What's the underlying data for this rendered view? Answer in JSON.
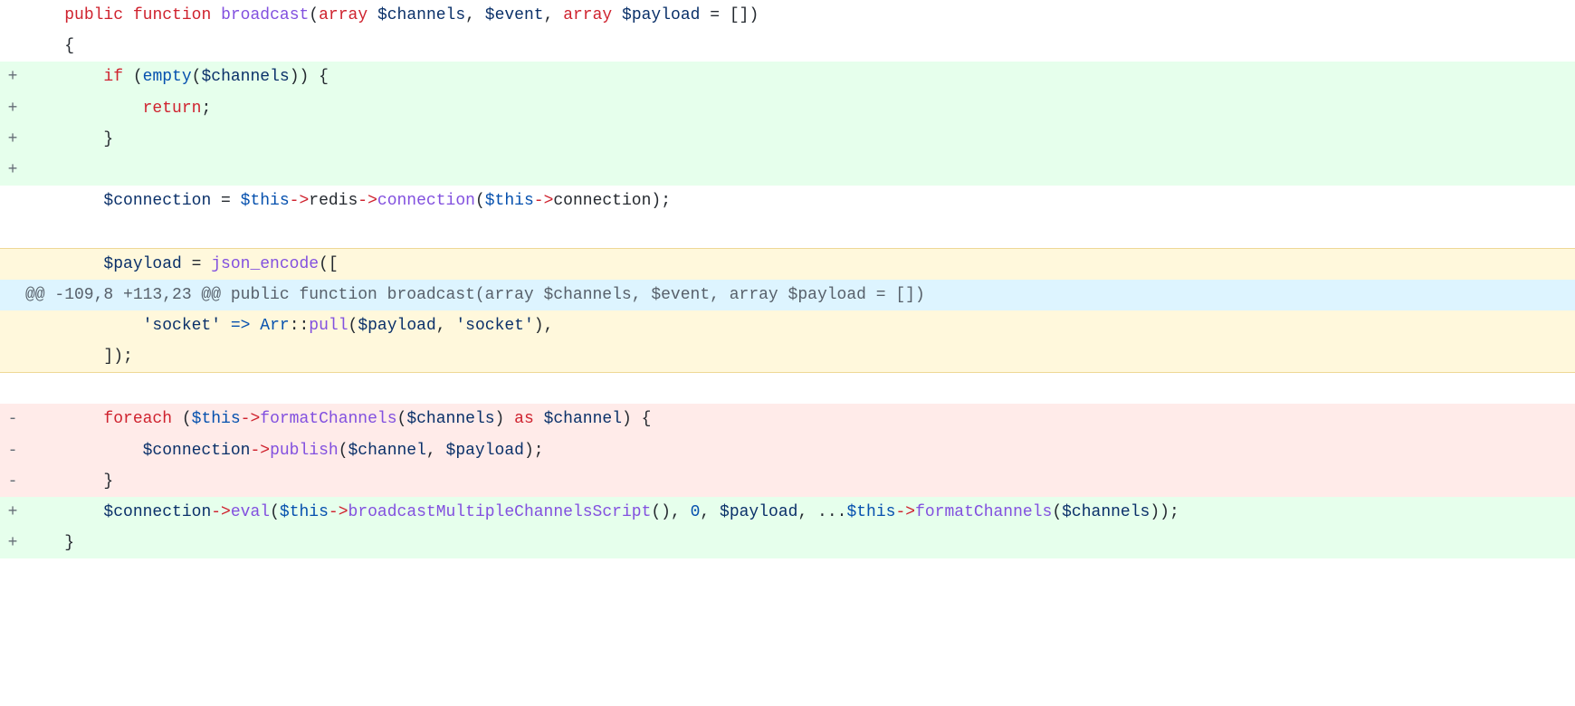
{
  "lines": [
    {
      "type": "context",
      "marker": "",
      "indent": "    ",
      "tokens": [
        {
          "t": "public",
          "c": "kw"
        },
        {
          "t": " "
        },
        {
          "t": "function",
          "c": "kw"
        },
        {
          "t": " "
        },
        {
          "t": "broadcast",
          "c": "fn"
        },
        {
          "t": "("
        },
        {
          "t": "array",
          "c": "kw"
        },
        {
          "t": " "
        },
        {
          "t": "$channels",
          "c": "var"
        },
        {
          "t": ", "
        },
        {
          "t": "$event",
          "c": "var"
        },
        {
          "t": ", "
        },
        {
          "t": "array",
          "c": "kw"
        },
        {
          "t": " "
        },
        {
          "t": "$payload",
          "c": "var"
        },
        {
          "t": " = []"
        },
        {
          "t": ")"
        }
      ]
    },
    {
      "type": "context",
      "marker": "",
      "indent": "    ",
      "tokens": [
        {
          "t": "{"
        }
      ]
    },
    {
      "type": "addition",
      "marker": "+",
      "indent": "        ",
      "tokens": [
        {
          "t": "if",
          "c": "kw"
        },
        {
          "t": " ("
        },
        {
          "t": "empty",
          "c": "kw-blue"
        },
        {
          "t": "("
        },
        {
          "t": "$channels",
          "c": "var"
        },
        {
          "t": ")) {"
        }
      ]
    },
    {
      "type": "addition",
      "marker": "+",
      "indent": "            ",
      "tokens": [
        {
          "t": "return",
          "c": "kw"
        },
        {
          "t": ";"
        }
      ]
    },
    {
      "type": "addition",
      "marker": "+",
      "indent": "        ",
      "tokens": [
        {
          "t": "}"
        }
      ]
    },
    {
      "type": "addition",
      "marker": "+",
      "indent": "",
      "tokens": []
    },
    {
      "type": "context",
      "marker": "",
      "indent": "        ",
      "tokens": [
        {
          "t": "$connection",
          "c": "var"
        },
        {
          "t": " = "
        },
        {
          "t": "$this",
          "c": "kw-blue"
        },
        {
          "t": "->",
          "c": "arrow"
        },
        {
          "t": "redis"
        },
        {
          "t": "->",
          "c": "arrow"
        },
        {
          "t": "connection",
          "c": "fn"
        },
        {
          "t": "("
        },
        {
          "t": "$this",
          "c": "kw-blue"
        },
        {
          "t": "->",
          "c": "arrow"
        },
        {
          "t": "connection"
        },
        {
          "t": ");"
        }
      ]
    },
    {
      "type": "blank",
      "marker": "",
      "indent": "",
      "tokens": []
    },
    {
      "type": "expand-top",
      "marker": "",
      "indent": "        ",
      "tokens": [
        {
          "t": "$payload",
          "c": "var"
        },
        {
          "t": " = "
        },
        {
          "t": "json_encode",
          "c": "fn"
        },
        {
          "t": "(["
        }
      ]
    },
    {
      "type": "hunk",
      "marker": "",
      "indent": "",
      "hunk_text": "@@ -109,8 +113,23 @@ public function broadcast(array $channels, $event, array $payload = [])"
    },
    {
      "type": "expand",
      "marker": "",
      "indent": "            ",
      "tokens": [
        {
          "t": "'socket'",
          "c": "str"
        },
        {
          "t": " "
        },
        {
          "t": "=>",
          "c": "kw-blue"
        },
        {
          "t": " "
        },
        {
          "t": "Arr",
          "c": "kw-blue"
        },
        {
          "t": "::"
        },
        {
          "t": "pull",
          "c": "fn"
        },
        {
          "t": "("
        },
        {
          "t": "$payload",
          "c": "var"
        },
        {
          "t": ", "
        },
        {
          "t": "'socket'",
          "c": "str"
        },
        {
          "t": "),"
        }
      ]
    },
    {
      "type": "expand-bottom",
      "marker": "",
      "indent": "        ",
      "tokens": [
        {
          "t": "]);"
        }
      ]
    },
    {
      "type": "blank",
      "marker": "",
      "indent": "",
      "tokens": []
    },
    {
      "type": "deletion",
      "marker": "-",
      "indent": "        ",
      "tokens": [
        {
          "t": "foreach",
          "c": "kw"
        },
        {
          "t": " ("
        },
        {
          "t": "$this",
          "c": "kw-blue"
        },
        {
          "t": "->",
          "c": "arrow"
        },
        {
          "t": "formatChannels",
          "c": "fn"
        },
        {
          "t": "("
        },
        {
          "t": "$channels",
          "c": "var"
        },
        {
          "t": ") "
        },
        {
          "t": "as",
          "c": "kw"
        },
        {
          "t": " "
        },
        {
          "t": "$channel",
          "c": "var"
        },
        {
          "t": ") {"
        }
      ]
    },
    {
      "type": "deletion",
      "marker": "-",
      "indent": "            ",
      "tokens": [
        {
          "t": "$connection",
          "c": "var"
        },
        {
          "t": "->",
          "c": "arrow"
        },
        {
          "t": "publish",
          "c": "fn"
        },
        {
          "t": "("
        },
        {
          "t": "$channel",
          "c": "var"
        },
        {
          "t": ", "
        },
        {
          "t": "$payload",
          "c": "var"
        },
        {
          "t": ");"
        }
      ]
    },
    {
      "type": "deletion",
      "marker": "-",
      "indent": "        ",
      "tokens": [
        {
          "t": "}"
        }
      ]
    },
    {
      "type": "addition",
      "marker": "+",
      "indent": "        ",
      "tokens": [
        {
          "t": "$connection",
          "c": "var"
        },
        {
          "t": "->",
          "c": "arrow"
        },
        {
          "t": "eval",
          "c": "fn"
        },
        {
          "t": "("
        },
        {
          "t": "$this",
          "c": "kw-blue"
        },
        {
          "t": "->",
          "c": "arrow"
        },
        {
          "t": "broadcastMultipleChannelsScript",
          "c": "fn"
        },
        {
          "t": "(), "
        },
        {
          "t": "0",
          "c": "num"
        },
        {
          "t": ", "
        },
        {
          "t": "$payload",
          "c": "var"
        },
        {
          "t": ", ..."
        },
        {
          "t": "$this",
          "c": "kw-blue"
        },
        {
          "t": "->",
          "c": "arrow"
        },
        {
          "t": "formatChannels",
          "c": "fn"
        },
        {
          "t": "("
        },
        {
          "t": "$channels",
          "c": "var"
        },
        {
          "t": "));"
        }
      ]
    },
    {
      "type": "addition",
      "marker": "+",
      "indent": "    ",
      "tokens": [
        {
          "t": "}"
        }
      ]
    }
  ]
}
